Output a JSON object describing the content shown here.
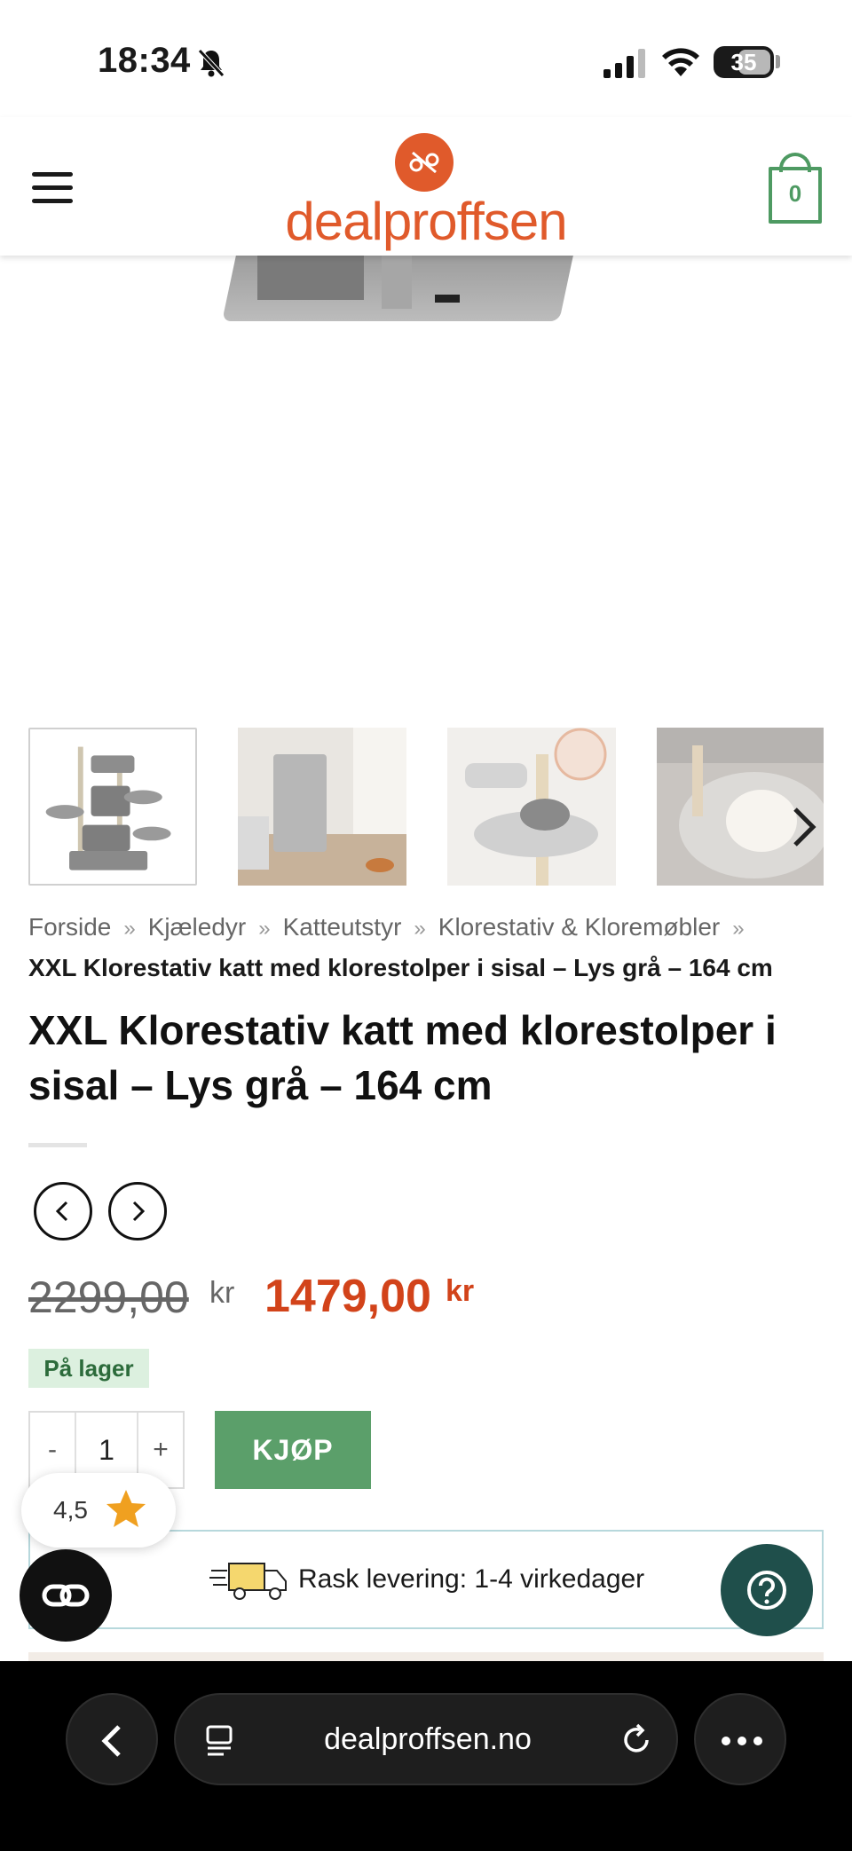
{
  "status_bar": {
    "time": "18:34",
    "battery": "35"
  },
  "header": {
    "logo_text": "dealproffsen",
    "cart_count": "0"
  },
  "breadcrumb": {
    "items": [
      "Forside",
      "Kjæledyr",
      "Katteutstyr",
      "Klorestativ & Kloremøbler"
    ],
    "separator": "»",
    "current": "XXL Klorestativ katt med klorestolper i sisal – Lys grå – 164 cm"
  },
  "product": {
    "title": "XXL Klorestativ katt med klorestolper i sisal – Lys grå – 164 cm",
    "price_old": "2299,00",
    "price_new": "1479,00",
    "currency": "kr",
    "stock": "På lager",
    "quantity": "1",
    "qty_minus": "-",
    "qty_plus": "+",
    "buy_label": "KJØP"
  },
  "rating": {
    "value": "4,5",
    "star_color": "#f0a020"
  },
  "delivery": {
    "text": "Rask levering: 1-4 virkedager"
  },
  "browser": {
    "url": "dealproffsen.no"
  },
  "colors": {
    "brand": "#e05a2b",
    "green": "#5b9f6a",
    "price_red": "#d2431a",
    "help_fab": "#1f4f4b"
  },
  "icons": {
    "menu": "hamburger-icon",
    "cart": "cart-icon",
    "prev": "chevron-left-icon",
    "next": "chevron-right-icon",
    "star": "star-icon",
    "truck": "delivery-truck-icon",
    "help": "question-icon",
    "link": "link-icon"
  }
}
